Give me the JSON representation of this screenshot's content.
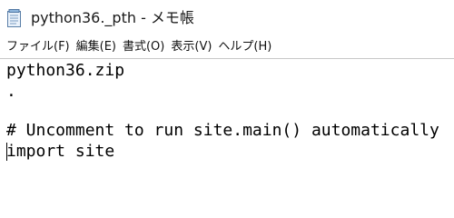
{
  "window": {
    "title": "python36._pth - メモ帳"
  },
  "menubar": {
    "items": [
      {
        "label": "ファイル(F)"
      },
      {
        "label": "編集(E)"
      },
      {
        "label": "書式(O)"
      },
      {
        "label": "表示(V)"
      },
      {
        "label": "ヘルプ(H)"
      }
    ]
  },
  "editor": {
    "lines": [
      "python36.zip",
      ".",
      "",
      "# Uncomment to run site.main() automatically",
      "import site"
    ]
  },
  "icons": {
    "app": "notepad-icon"
  }
}
